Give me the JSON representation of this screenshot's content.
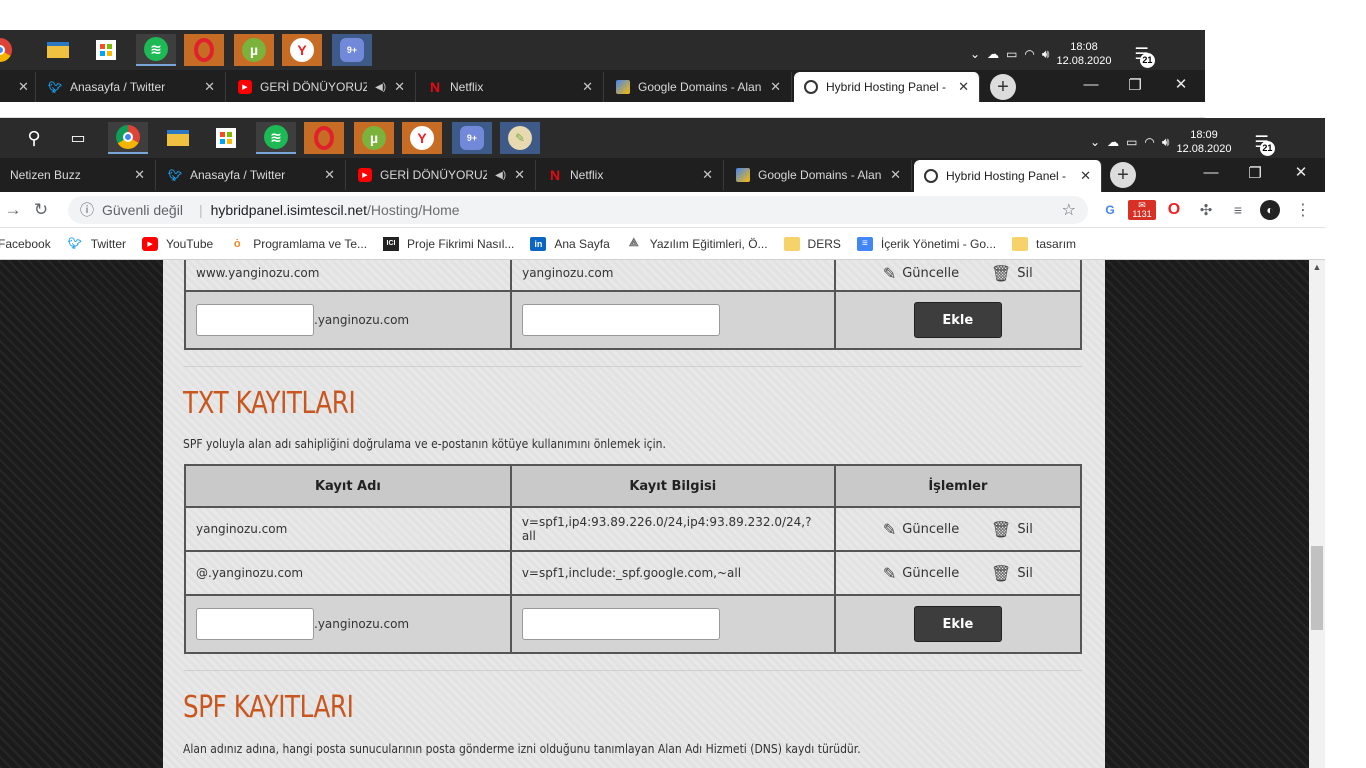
{
  "back_window": {
    "clock": {
      "time": "18:08",
      "date": "12.08.2020"
    },
    "notification_count": "21",
    "tabs": [
      {
        "title": "Anasayfa / Twitter"
      },
      {
        "title": "GERİ DÖNÜYORUZ!"
      },
      {
        "title": "Netflix"
      },
      {
        "title": "Google Domains - Alan"
      },
      {
        "title": "Hybrid Hosting Panel -"
      }
    ]
  },
  "front_window": {
    "clock": {
      "time": "18:09",
      "date": "12.08.2020"
    },
    "notification_count": "21",
    "tabs": [
      {
        "title": "Netizen Buzz"
      },
      {
        "title": "Anasayfa / Twitter"
      },
      {
        "title": "GERİ DÖNÜYORUZ!"
      },
      {
        "title": "Netflix"
      },
      {
        "title": "Google Domains - Alan"
      },
      {
        "title": "Hybrid Hosting Panel -"
      }
    ],
    "address": {
      "security_label": "Güvenli değil",
      "host": "hybridpanel.isimtescil.net",
      "path": "/Hosting/Home"
    },
    "extension_badge": "1131",
    "bookmarks": [
      {
        "label": "Facebook",
        "icon": "facebook-icon"
      },
      {
        "label": "Twitter",
        "icon": "twitter-icon"
      },
      {
        "label": "YouTube",
        "icon": "youtube-icon"
      },
      {
        "label": "Programlama ve Te...",
        "icon": "code-icon"
      },
      {
        "label": "Proje Fikrimi Nasıl...",
        "icon": "project-icon"
      },
      {
        "label": "Ana Sayfa",
        "icon": "linkedin-icon"
      },
      {
        "label": "Yazılım Eğitimleri, Ö...",
        "icon": "education-icon"
      },
      {
        "label": "DERS",
        "icon": "folder-icon"
      },
      {
        "label": "İçerik Yönetimi - Go...",
        "icon": "docs-icon"
      },
      {
        "label": "tasarım",
        "icon": "folder-icon"
      }
    ]
  },
  "page": {
    "prev_table": {
      "row": {
        "name": "www.yanginozu.com",
        "value": "yanginozu.com"
      },
      "suffix": ".yanginozu.com",
      "add_label": "Ekle"
    },
    "txt": {
      "title": "TXT KAYITLARI",
      "description": "SPF yoluyla alan adı sahipliğini doğrulama ve e-postanın kötüye kullanımını önlemek için.",
      "headers": [
        "Kayıt Adı",
        "Kayıt Bilgisi",
        "İşlemler"
      ],
      "rows": [
        {
          "name": "yanginozu.com",
          "value": "v=spf1,ip4:93.89.226.0/24,ip4:93.89.232.0/24,?all"
        },
        {
          "name": "@.yanginozu.com",
          "value": "v=spf1,include:_spf.google.com,~all"
        }
      ],
      "suffix": ".yanginozu.com",
      "add_label": "Ekle"
    },
    "ops": {
      "update_label": "Güncelle",
      "delete_label": "Sil"
    },
    "spf": {
      "title": "SPF KAYITLARI",
      "description": "Alan adınız adına, hangi posta sunucularının posta gönderme izni olduğunu tanımlayan Alan Adı Hizmeti (DNS) kaydı türüdür."
    }
  }
}
